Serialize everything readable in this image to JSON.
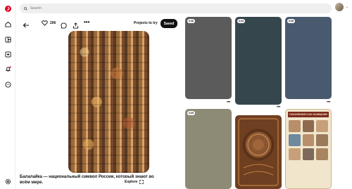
{
  "search": {
    "placeholder": "Search"
  },
  "pin": {
    "like_count": "206",
    "projects_label": "Projects to try",
    "saved_label": "Saved",
    "explore_label": "Explore",
    "title": "Балалайка — национальный символ России, который знают во всём мире."
  },
  "grid": {
    "cards": [
      {
        "badge": "0:06",
        "color": "#5b5b5b"
      },
      {
        "badge": "0:04",
        "color": "#36464d"
      },
      {
        "badge": "0:06",
        "color": "#4a5a6e"
      },
      {
        "badge": "0:09",
        "color": "#8d8b76"
      }
    ],
    "poster_title": "ПОКОЛЕНИЯ И ИХ НАЗВАНИЯ"
  },
  "colors": {
    "accent": "#e60023",
    "saved_bg": "#111111"
  }
}
